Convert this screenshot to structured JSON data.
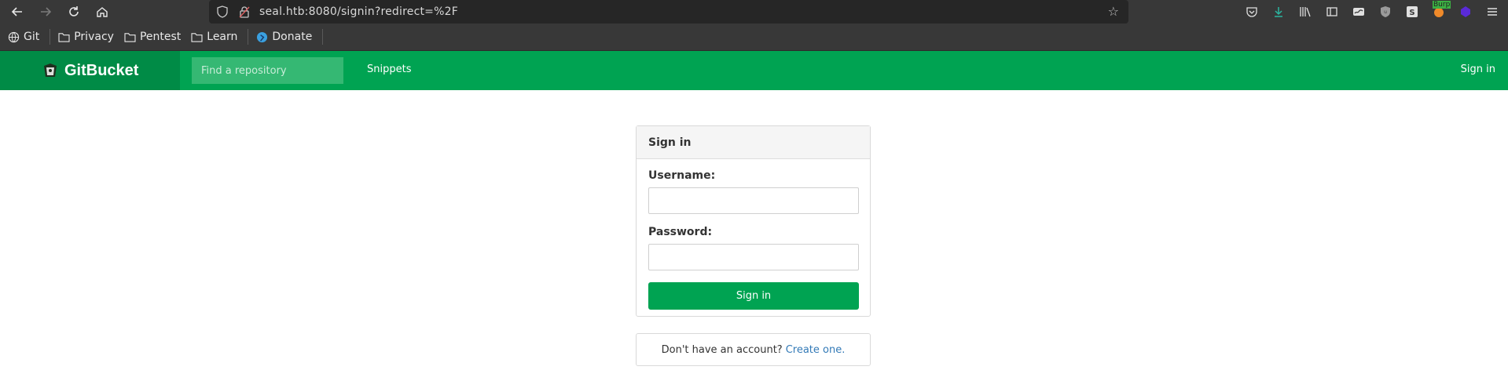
{
  "browser": {
    "url": "seal.htb:8080/signin?redirect=%2F",
    "extensions": [
      "pocket-icon",
      "download-icon",
      "library-icon",
      "sidebar-icon",
      "wave-icon",
      "shield-icon",
      "s-icon",
      "burp-icon",
      "cube-icon",
      "menu-icon"
    ],
    "burp_label": "Burp"
  },
  "bookmarks": [
    {
      "label": "Git",
      "icon": "globe-icon"
    },
    {
      "label": "Privacy",
      "icon": "folder-icon"
    },
    {
      "label": "Pentest",
      "icon": "folder-icon"
    },
    {
      "label": "Learn",
      "icon": "folder-icon"
    },
    {
      "label": "Donate",
      "icon": "donate-icon"
    }
  ],
  "header": {
    "brand": "GitBucket",
    "search_placeholder": "Find a repository",
    "snippets": "Snippets",
    "sign_in": "Sign in"
  },
  "signin": {
    "title": "Sign in",
    "username_label": "Username:",
    "password_label": "Password:",
    "submit_label": "Sign in"
  },
  "register": {
    "prompt": "Don't have an account?",
    "link": "Create one."
  },
  "colors": {
    "accent": "#00a352",
    "brand_bg": "#008b46",
    "link": "#337ab7"
  }
}
